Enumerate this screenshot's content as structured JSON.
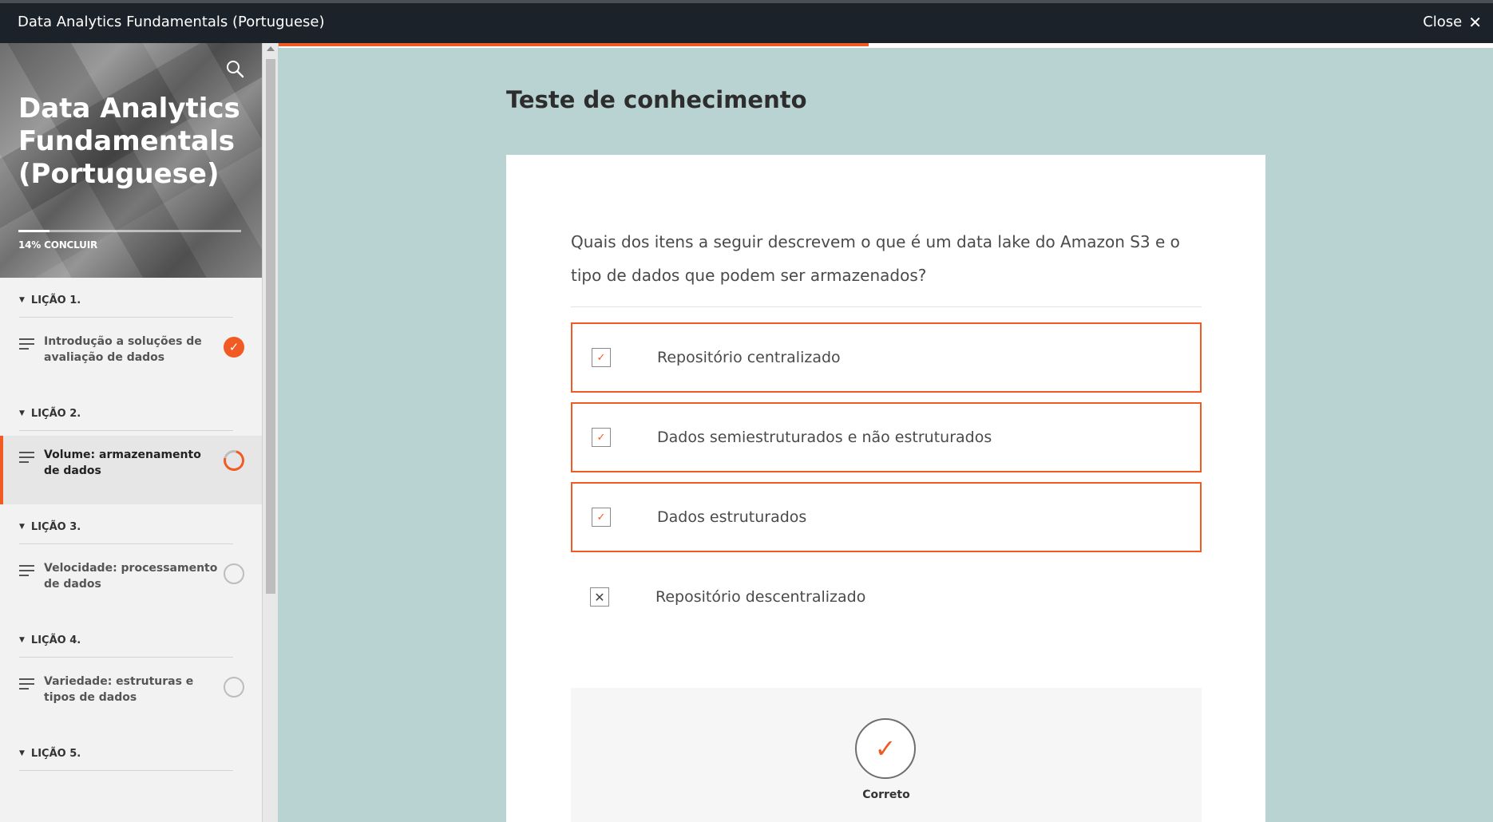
{
  "window": {
    "title": "Data Analytics Fundamentals (Portuguese)",
    "close_label": "Close",
    "close_symbol": "✕",
    "top_progress_fraction": 0.486
  },
  "sidebar": {
    "course_title": "Data Analytics Fundamentals (Portuguese)",
    "progress_percent": 14,
    "progress_label": "14% CONCLUIR",
    "lessons": [
      {
        "heading": "LIÇÃO 1.",
        "item": "Introdução a soluções de avaliação de dados",
        "status": "complete"
      },
      {
        "heading": "LIÇÃO 2.",
        "item": "Volume: armazenamento de dados",
        "status": "in-progress",
        "active": true
      },
      {
        "heading": "LIÇÃO 3.",
        "item": "Velocidade: processamento de dados",
        "status": "not-started"
      },
      {
        "heading": "LIÇÃO 4.",
        "item": "Variedade: estruturas e tipos de dados",
        "status": "not-started"
      },
      {
        "heading": "LIÇÃO 5."
      }
    ]
  },
  "main": {
    "title": "Teste de conhecimento",
    "question": "Quais dos itens a seguir descrevem o que é um data lake do Amazon S3 e o tipo de dados que podem ser armazenados?",
    "options": [
      {
        "label": "Repositório centralizado",
        "selected": true,
        "mark": "✓"
      },
      {
        "label": "Dados semiestruturados e não estruturados",
        "selected": true,
        "mark": "✓"
      },
      {
        "label": "Dados estruturados",
        "selected": true,
        "mark": "✓"
      },
      {
        "label": "Repositório descentralizado",
        "selected": false,
        "mark": "✕"
      }
    ],
    "feedback": {
      "label": "Correto",
      "symbol": "✓"
    }
  },
  "colors": {
    "accent": "#f15a22",
    "topbar": "#1c222a",
    "background": "#b9d3d3"
  }
}
